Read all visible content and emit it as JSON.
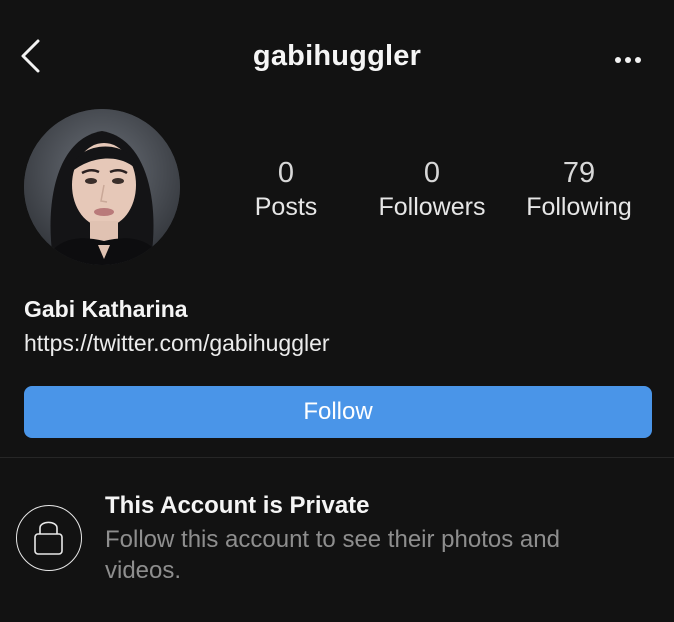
{
  "header": {
    "username": "gabihuggler",
    "back_icon": "chevron-left-icon",
    "more_icon": "ellipsis-icon"
  },
  "profile": {
    "avatar": "profile-photo",
    "stats": [
      {
        "value": "0",
        "label": "Posts"
      },
      {
        "value": "0",
        "label": "Followers"
      },
      {
        "value": "79",
        "label": "Following"
      }
    ],
    "full_name": "Gabi Katharina",
    "website": "https://twitter.com/gabihuggler"
  },
  "actions": {
    "follow_label": "Follow"
  },
  "private_notice": {
    "icon": "lock-icon",
    "title": "This Account is Private",
    "subtitle": "Follow this account to see their photos and videos."
  },
  "colors": {
    "background": "#121212",
    "follow_button": "#4a95e8",
    "secondary_text": "#8e8e8e"
  }
}
